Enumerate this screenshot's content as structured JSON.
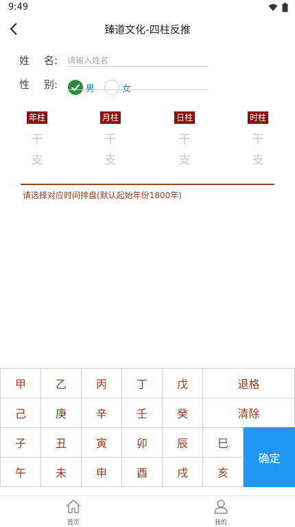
{
  "status": {
    "time": "9:49"
  },
  "nav": {
    "title": "臻道文化-四柱反推"
  },
  "form": {
    "name_label_1": "姓",
    "name_label_2": "名:",
    "name_placeholder": "请输入姓名",
    "name_value": "",
    "gender_label_1": "性",
    "gender_label_2": "别:",
    "male": "男",
    "female": "女",
    "selected_gender": "男"
  },
  "pillars": [
    {
      "header": "年柱",
      "gan": "干",
      "zhi": "支"
    },
    {
      "header": "月柱",
      "gan": "干",
      "zhi": "支"
    },
    {
      "header": "日柱",
      "gan": "干",
      "zhi": "支"
    },
    {
      "header": "时柱",
      "gan": "干",
      "zhi": "支"
    }
  ],
  "hint": "请选择对应时间排盘(默认起始年份1800年)",
  "keyboard": {
    "row1": [
      "甲",
      "乙",
      "丙",
      "丁",
      "戊"
    ],
    "row2": [
      "己",
      "庚",
      "辛",
      "壬",
      "癸"
    ],
    "row3": [
      "子",
      "丑",
      "寅",
      "卯",
      "辰",
      "巳"
    ],
    "row4": [
      "午",
      "未",
      "申",
      "酉",
      "戌",
      "亥"
    ],
    "backspace": "退格",
    "clear": "清除",
    "confirm": "确定"
  },
  "tabs": {
    "home": "首页",
    "mine": "我的"
  },
  "colors": {
    "accent": "#1e98f0",
    "pillar_header": "#8f1010",
    "key_text": "#9b3a1a",
    "checked": "#2a8b3f"
  }
}
